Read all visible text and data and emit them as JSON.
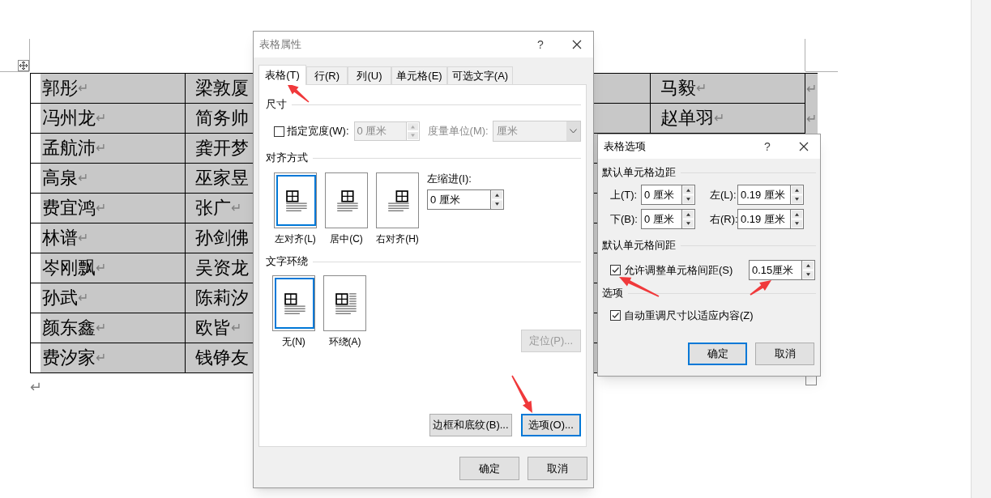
{
  "document": {
    "rows": [
      {
        "cells": [
          {
            "text": "郭彤",
            "mark": "↵"
          },
          {
            "text": "梁敦厦"
          },
          {
            "text": "马毅",
            "mark": "↵"
          },
          {
            "text": "",
            "mark": "↵"
          }
        ]
      },
      {
        "cells": [
          {
            "text": "冯州龙",
            "mark": "↵"
          },
          {
            "text": "简务帅"
          },
          {
            "text": "赵单羽",
            "mark": "↵"
          },
          {
            "text": "",
            "mark": "↵"
          }
        ]
      },
      {
        "cells": [
          {
            "text": "孟航沛",
            "mark": "↵"
          },
          {
            "text": "龚开梦"
          }
        ]
      },
      {
        "cells": [
          {
            "text": "高泉",
            "mark": "↵"
          },
          {
            "text": "巫家昱"
          }
        ]
      },
      {
        "cells": [
          {
            "text": "费宜鸿",
            "mark": "↵"
          },
          {
            "text": "张广",
            "mark": "↵"
          }
        ]
      },
      {
        "cells": [
          {
            "text": "林谱",
            "mark": "↵"
          },
          {
            "text": "孙剑佛"
          }
        ]
      },
      {
        "cells": [
          {
            "text": "岑刚飘",
            "mark": "↵"
          },
          {
            "text": "吴资龙"
          }
        ]
      },
      {
        "cells": [
          {
            "text": "孙武",
            "mark": "↵"
          },
          {
            "text": "陈莉汐"
          }
        ]
      },
      {
        "cells": [
          {
            "text": "颜东鑫",
            "mark": "↵"
          },
          {
            "text": "欧皆",
            "mark": "↵"
          }
        ]
      },
      {
        "cells": [
          {
            "text": "费汐家",
            "mark": "↵"
          },
          {
            "text": "钱铮友"
          }
        ]
      }
    ],
    "final_mark": "↵"
  },
  "table_properties": {
    "title": "表格属性",
    "help": "?",
    "tabs": [
      {
        "label": "表格(T)",
        "selected": true
      },
      {
        "label": "行(R)",
        "selected": false
      },
      {
        "label": "列(U)",
        "selected": false
      },
      {
        "label": "单元格(E)",
        "selected": false
      },
      {
        "label": "可选文字(A)",
        "selected": false
      }
    ],
    "size": {
      "heading": "尺寸",
      "width_checkbox": {
        "label": "指定宽度(W):",
        "checked": false
      },
      "width_field": {
        "value": "0 厘米",
        "disabled": true
      },
      "unit_label": {
        "text": "度量单位(M):",
        "disabled": true
      },
      "unit_select": {
        "value": "厘米",
        "disabled": true
      }
    },
    "alignment": {
      "heading": "对齐方式",
      "options": [
        {
          "kind": "left",
          "label": "左对齐(L)",
          "selected": true
        },
        {
          "kind": "center",
          "label": "居中(C)",
          "selected": false
        },
        {
          "kind": "right",
          "label": "右对齐(H)",
          "selected": false
        }
      ],
      "indent_label": "左缩进(I):",
      "indent_field": {
        "value": "0 厘米"
      }
    },
    "wrapping": {
      "heading": "文字环绕",
      "options": [
        {
          "kind": "none",
          "label": "无(N)",
          "selected": true
        },
        {
          "kind": "around",
          "label": "环绕(A)",
          "selected": false
        }
      ],
      "position_button": {
        "label": "定位(P)...",
        "disabled": true
      }
    },
    "buttons": [
      {
        "label": "边框和底纹(B)...",
        "focused": false
      },
      {
        "label": "选项(O)...",
        "focused": true
      }
    ],
    "footer_buttons": [
      {
        "label": "确定",
        "focused": false
      },
      {
        "label": "取消",
        "focused": false
      }
    ]
  },
  "table_options": {
    "title": "表格选项",
    "help": "?",
    "margins_heading": "默认单元格边距",
    "margins": [
      {
        "label": "上(T):",
        "value": "0 厘米"
      },
      {
        "label": "左(L):",
        "value": "0.19 厘米"
      },
      {
        "label": "下(B):",
        "value": "0 厘米"
      },
      {
        "label": "右(R):",
        "value": "0.19 厘米"
      }
    ],
    "spacing_heading": "默认单元格间距",
    "spacing": {
      "label": "允许调整单元格间距(S)",
      "checked": true,
      "value": "0.15厘米"
    },
    "options_heading": "选项",
    "options": [
      {
        "label": "自动重调尺寸以适应内容(Z)",
        "checked": true
      }
    ],
    "buttons": [
      {
        "label": "确定",
        "focused": true
      },
      {
        "label": "取消",
        "focused": false
      }
    ]
  }
}
